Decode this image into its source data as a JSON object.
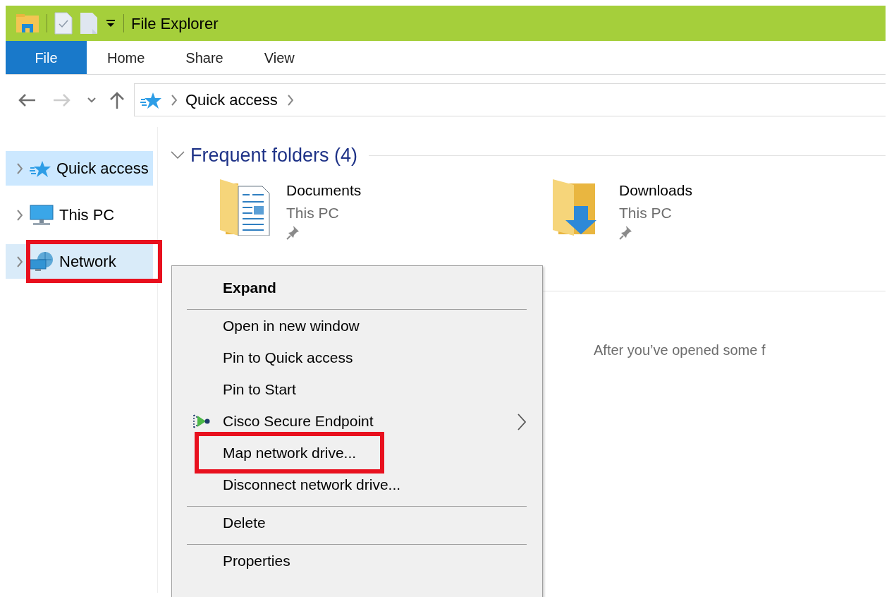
{
  "window": {
    "title": "File Explorer"
  },
  "ribbon_tabs": [
    {
      "label": "File",
      "selected": true
    },
    {
      "label": "Home",
      "selected": false
    },
    {
      "label": "Share",
      "selected": false
    },
    {
      "label": "View",
      "selected": false
    }
  ],
  "navigation": {
    "back_disabled": false,
    "forward_disabled": true
  },
  "address_bar": {
    "path": [
      "Quick access"
    ]
  },
  "sidebar": {
    "items": [
      {
        "label": "Quick access",
        "selected": true,
        "hovered": false,
        "annotated": false
      },
      {
        "label": "This PC",
        "selected": false,
        "hovered": false,
        "annotated": false
      },
      {
        "label": "Network",
        "selected": false,
        "hovered": true,
        "annotated": true
      }
    ]
  },
  "content": {
    "group": {
      "title": "Frequent folders (4)",
      "expanded": true
    },
    "folders": [
      {
        "name": "Documents",
        "location": "This PC",
        "pinned": true
      },
      {
        "name": "Downloads",
        "location": "This PC",
        "pinned": true
      }
    ],
    "recent_hint": "After you’ve opened some f"
  },
  "context_menu": {
    "items": [
      {
        "kind": "item",
        "label": "Expand",
        "default": true,
        "icon": false,
        "submenu": false,
        "annotated": false
      },
      {
        "kind": "separator"
      },
      {
        "kind": "item",
        "label": "Open in new window",
        "default": false,
        "icon": false,
        "submenu": false,
        "annotated": false
      },
      {
        "kind": "item",
        "label": "Pin to Quick access",
        "default": false,
        "icon": false,
        "submenu": false,
        "annotated": false
      },
      {
        "kind": "item",
        "label": "Pin to Start",
        "default": false,
        "icon": false,
        "submenu": false,
        "annotated": false
      },
      {
        "kind": "item",
        "label": "Cisco Secure Endpoint",
        "default": false,
        "icon": true,
        "submenu": true,
        "annotated": false
      },
      {
        "kind": "item",
        "label": "Map network drive...",
        "default": false,
        "icon": false,
        "submenu": false,
        "annotated": true
      },
      {
        "kind": "item",
        "label": "Disconnect network drive...",
        "default": false,
        "icon": false,
        "submenu": false,
        "annotated": false
      },
      {
        "kind": "separator"
      },
      {
        "kind": "item",
        "label": "Delete",
        "default": false,
        "icon": false,
        "submenu": false,
        "annotated": false
      },
      {
        "kind": "separator"
      },
      {
        "kind": "item",
        "label": "Properties",
        "default": false,
        "icon": false,
        "submenu": false,
        "annotated": false
      }
    ]
  }
}
